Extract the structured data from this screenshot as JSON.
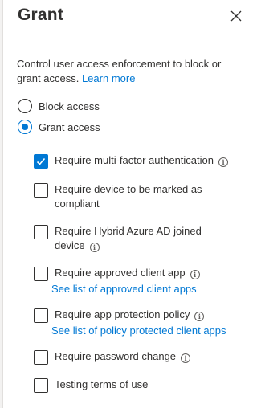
{
  "panel": {
    "title": "Grant",
    "description": "Control user access enforcement to block or grant access.",
    "learn_more": "Learn more"
  },
  "radios": [
    {
      "label": "Block access",
      "checked": false
    },
    {
      "label": "Grant access",
      "checked": true
    }
  ],
  "checkboxes": [
    {
      "label": "Require multi-factor authentication",
      "checked": true
    },
    {
      "label": "Require device to be marked as compliant",
      "checked": false
    },
    {
      "label": "Require Hybrid Azure AD joined device",
      "checked": false
    },
    {
      "label": "Require approved client app",
      "checked": false,
      "link": "See list of approved client apps"
    },
    {
      "label": "Require app protection policy",
      "checked": false,
      "link": "See list of policy protected client apps"
    },
    {
      "label": "Require password change",
      "checked": false
    },
    {
      "label": "Testing terms of use",
      "checked": false
    }
  ],
  "colors": {
    "accent": "#0078d4",
    "text": "#323130"
  }
}
